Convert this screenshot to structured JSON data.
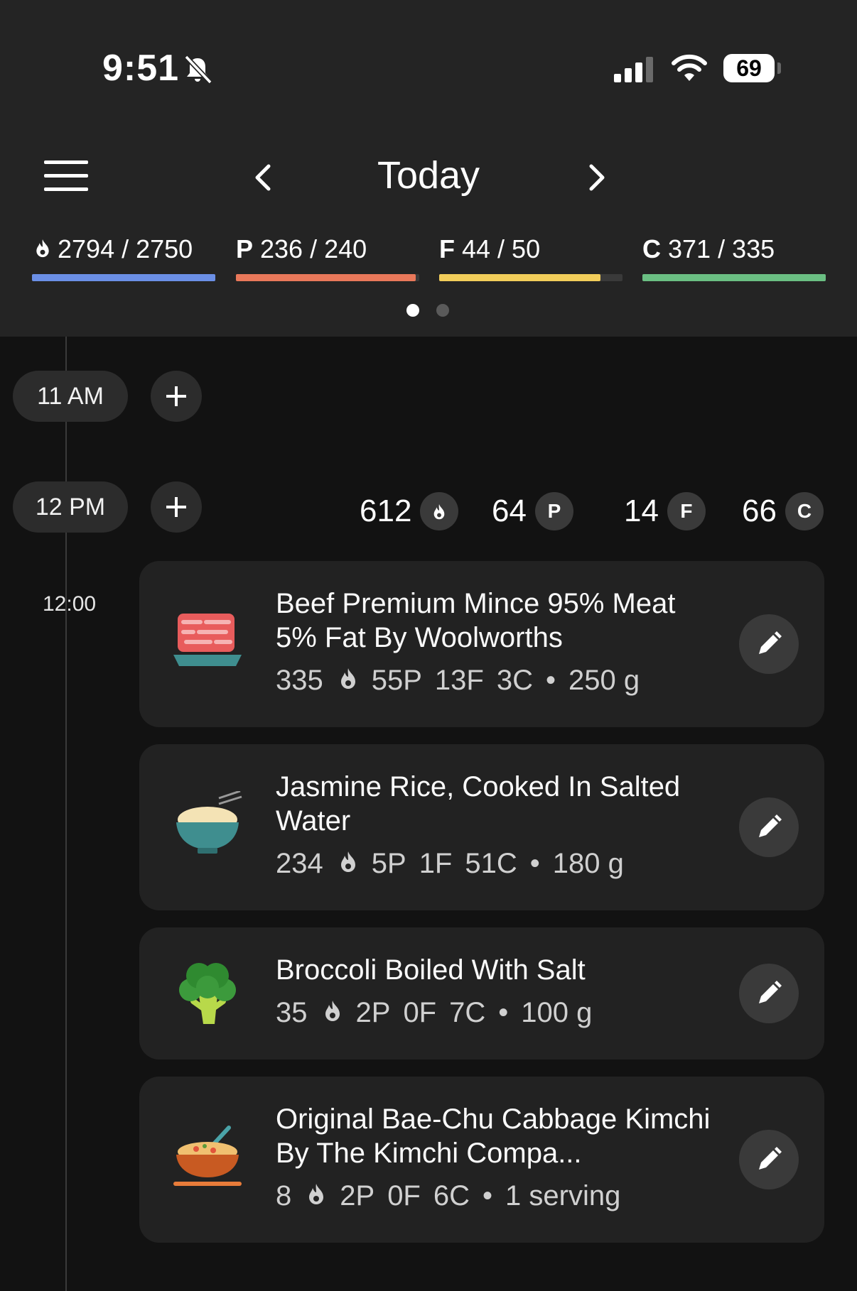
{
  "status_bar": {
    "time": "9:51",
    "battery": "69"
  },
  "nav": {
    "title": "Today"
  },
  "macros": [
    {
      "key": "calories",
      "prefix": "",
      "value": "2794 / 2750",
      "color": "#6b8fe6",
      "fill": 1.0
    },
    {
      "key": "protein",
      "prefix": "P",
      "value": "236 / 240",
      "color": "#e9785a",
      "fill": 0.98
    },
    {
      "key": "fat",
      "prefix": "F",
      "value": "44 / 50",
      "color": "#f2cd5a",
      "fill": 0.88
    },
    {
      "key": "carbs",
      "prefix": "C",
      "value": "371 / 335",
      "color": "#6bbf83",
      "fill": 1.0
    }
  ],
  "timeline": {
    "slot_1": {
      "label": "11 AM"
    },
    "slot_2": {
      "label": "12 PM",
      "totals": {
        "calories": "612",
        "protein": "64",
        "protein_badge": "P",
        "fat": "14",
        "fat_badge": "F",
        "carbs": "66",
        "carbs_badge": "C"
      }
    },
    "time_label": "12:00"
  },
  "entries": [
    {
      "icon": "meat-icon",
      "name": "Beef Premium Mince 95% Meat 5% Fat By Woolworths",
      "cal": "335",
      "p": "55P",
      "f": "13F",
      "c": "3C",
      "sep": "•",
      "amount": "250 g"
    },
    {
      "icon": "rice-bowl-icon",
      "name": "Jasmine Rice, Cooked In Salted Water",
      "cal": "234",
      "p": "5P",
      "f": "1F",
      "c": "51C",
      "sep": "•",
      "amount": "180 g"
    },
    {
      "icon": "broccoli-icon",
      "name": "Broccoli Boiled With Salt",
      "cal": "35",
      "p": "2P",
      "f": "0F",
      "c": "7C",
      "sep": "•",
      "amount": "100 g"
    },
    {
      "icon": "kimchi-bowl-icon",
      "name": "Original Bae-Chu Cabbage Kimchi By The Kimchi Compa...",
      "cal": "8",
      "p": "2P",
      "f": "0F",
      "c": "6C",
      "sep": "•",
      "amount": "1 serving"
    }
  ]
}
